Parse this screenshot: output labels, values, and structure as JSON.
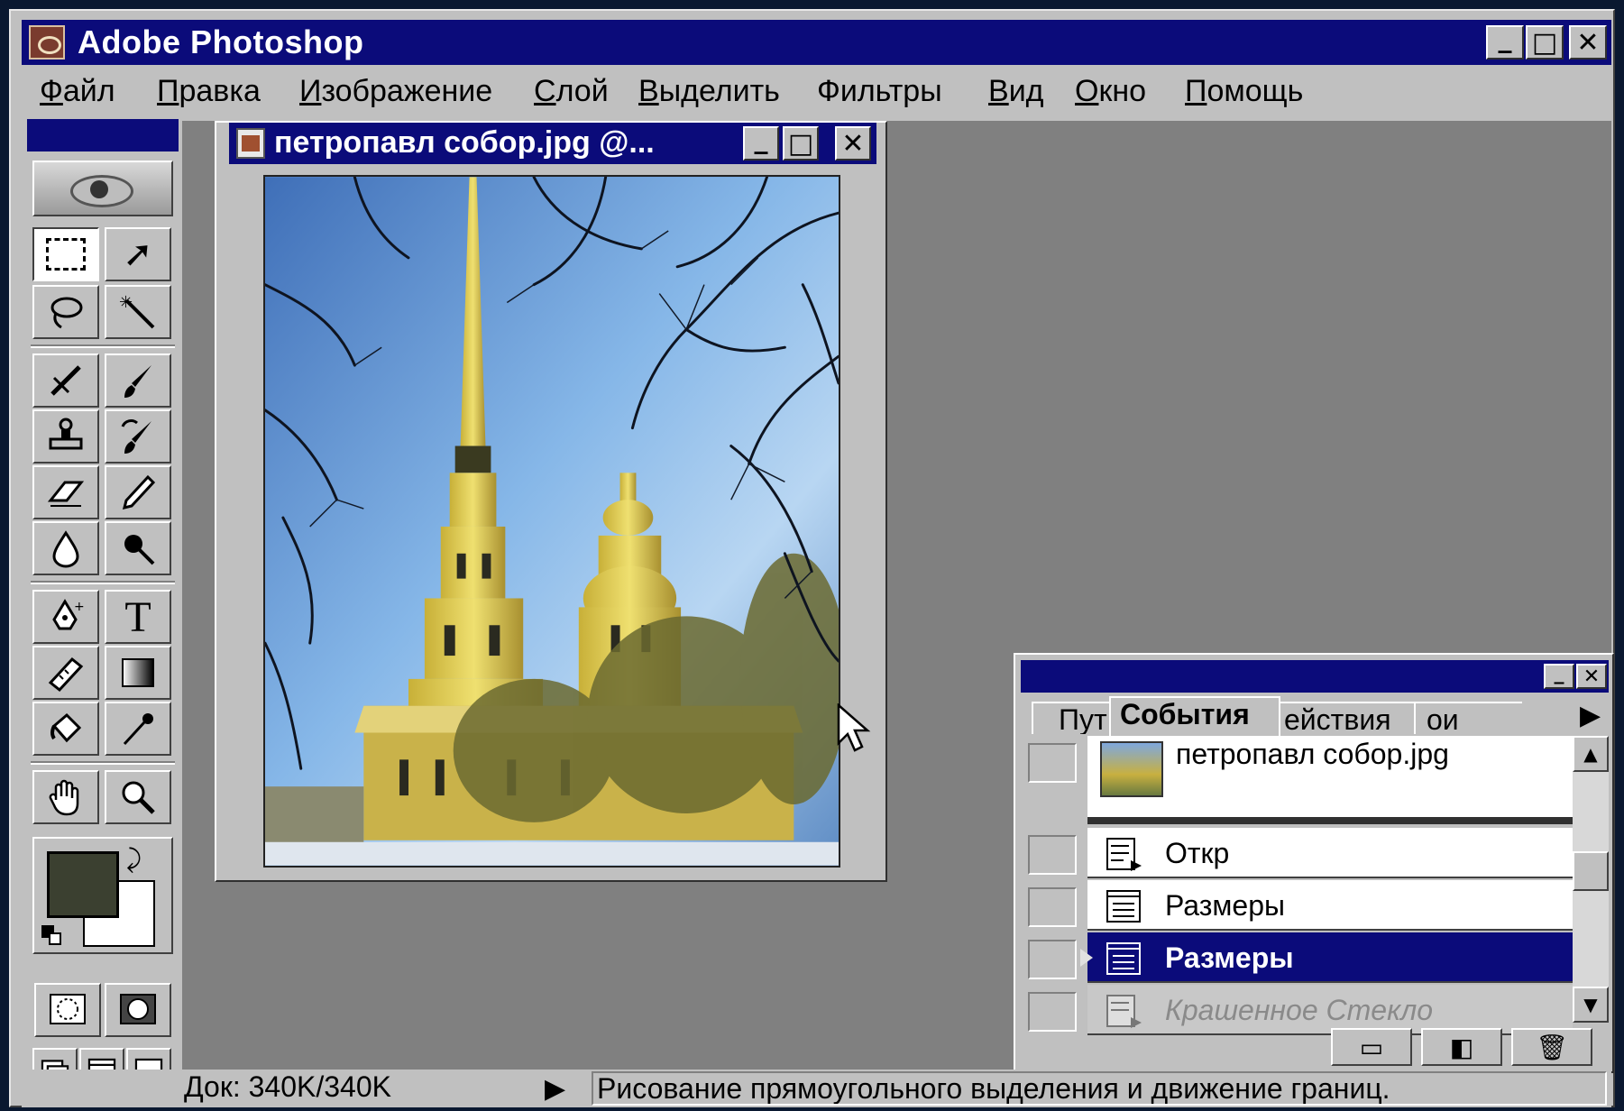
{
  "app": {
    "title": "Adobe Photoshop",
    "window_buttons": {
      "minimize": "_",
      "maximize": "□",
      "close": "✕"
    }
  },
  "menu": [
    {
      "first": "Ф",
      "rest": "айл"
    },
    {
      "first": "П",
      "rest": "равка"
    },
    {
      "first": "И",
      "rest": "зображение"
    },
    {
      "first": "С",
      "rest": "лой"
    },
    {
      "first": "В",
      "rest": "ыделить"
    },
    {
      "first": "",
      "rest": "Фильтры"
    },
    {
      "first": "В",
      "rest": "ид"
    },
    {
      "first": "О",
      "rest": "кно"
    },
    {
      "first": "П",
      "rest": "омощь"
    }
  ],
  "toolbox": {
    "tools": [
      "marquee-tool",
      "move-tool",
      "lasso-tool",
      "magic-wand-tool",
      "airbrush-tool",
      "paintbrush-tool",
      "rubber-stamp-tool",
      "history-brush-tool",
      "eraser-tool",
      "pencil-tool",
      "blur-tool",
      "burn-tool",
      "pen-tool",
      "type-tool",
      "measure-tool",
      "gradient-tool",
      "paint-bucket-tool",
      "eyedropper-tool",
      "hand-tool",
      "zoom-tool"
    ],
    "type_glyph": "T",
    "colors": {
      "foreground": "#3b4030",
      "background": "#ffffff"
    }
  },
  "document": {
    "title": "петропавл собор.jpg @..."
  },
  "history_panel": {
    "tabs": [
      "Пути",
      "События",
      "Действия",
      "Слои"
    ],
    "tab_labels_visible": {
      "paths": "Пут",
      "history": "События",
      "actions": "ействия",
      "layers": "ои"
    },
    "snapshot": "петропавл собор.jpg",
    "items": [
      {
        "label": "Откр",
        "selected": false,
        "disabled": false
      },
      {
        "label": "Размеры",
        "selected": false,
        "disabled": false
      },
      {
        "label": "Размеры",
        "selected": true,
        "disabled": false
      },
      {
        "label": "Крашенное Стекло",
        "selected": false,
        "disabled": true
      }
    ]
  },
  "status": {
    "doc_size": "Док: 340K/340K",
    "hint": "Рисование прямоугольного выделения и движение границ."
  }
}
